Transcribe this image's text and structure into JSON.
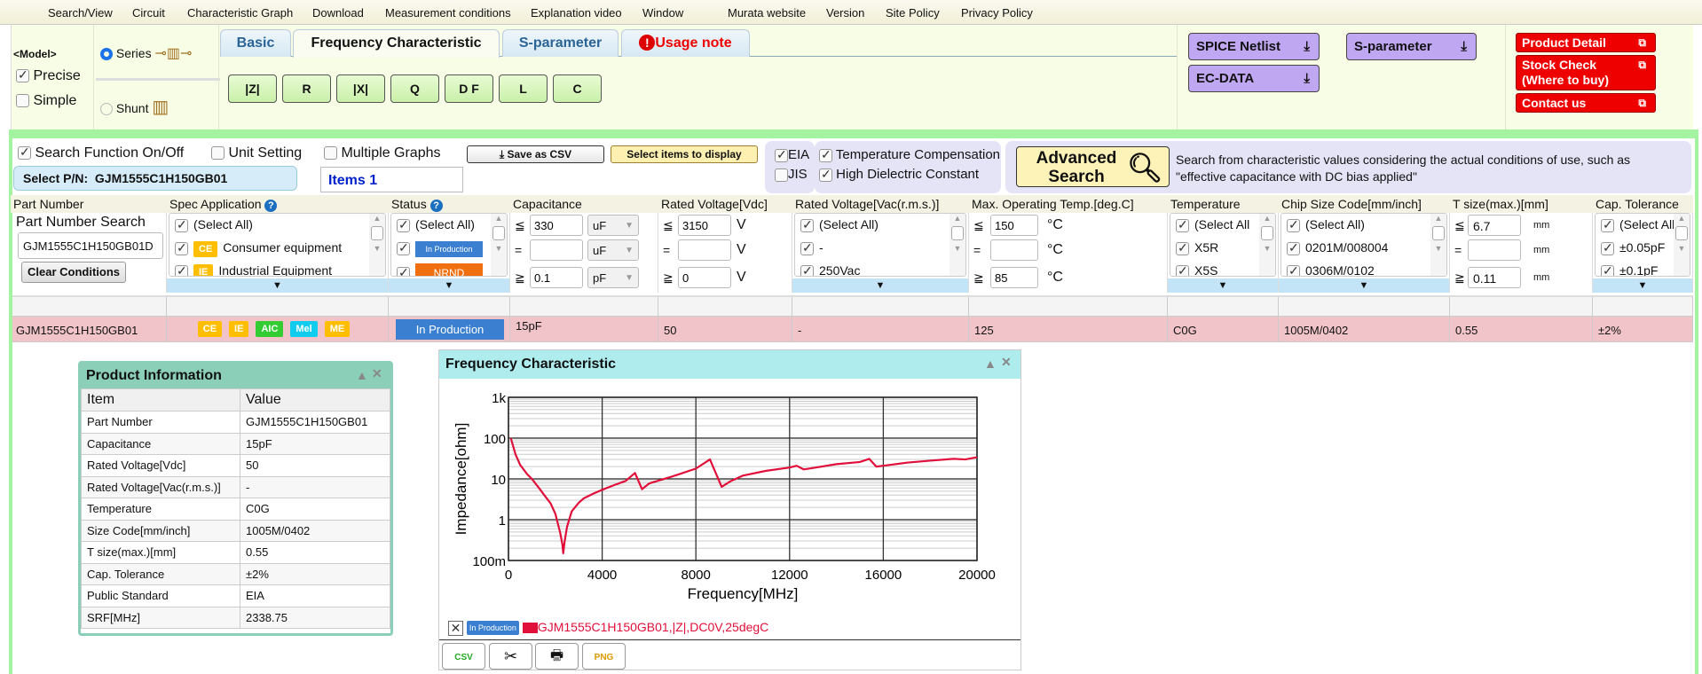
{
  "menu": [
    "Search/View",
    "Circuit",
    "Characteristic Graph",
    "Download",
    "Measurement conditions",
    "Explanation video",
    "Window",
    "Murata website",
    "Version",
    "Site Policy",
    "Privacy Policy"
  ],
  "model": {
    "label": "<Model>",
    "precise": "Precise",
    "simple": "Simple",
    "precise_checked": true,
    "simple_checked": false,
    "series": "Series",
    "shunt": "Shunt",
    "selected": "Series"
  },
  "tabs": [
    {
      "label": "Basic"
    },
    {
      "label": "Frequency Characteristic",
      "active": true
    },
    {
      "label": "S-parameter"
    },
    {
      "label": "Usage note",
      "icon": "exclamation-icon"
    }
  ],
  "graph_buttons": [
    "|Z|",
    "R",
    "|X|",
    "Q",
    "D F",
    "L",
    "C"
  ],
  "downloads": {
    "spice": "SPICE Netlist",
    "sparam": "S-parameter",
    "ecdata": "EC-DATA"
  },
  "links": {
    "product_detail": "Product Detail",
    "stock_check_1": "Stock Check",
    "stock_check_2": "(Where to buy)",
    "contact": "Contact us"
  },
  "search": {
    "search_on": "Search Function On/Off",
    "unit_setting": "Unit Setting",
    "multiple_graphs": "Multiple Graphs",
    "save_csv": "Save as CSV",
    "select_items": "Select items to display",
    "select_pn_label": "Select P/N:",
    "select_pn": "GJM1555C1H150GB01",
    "items": "Items 1",
    "eia": "EIA",
    "jis": "JIS",
    "temp_comp": "Temperature Compensation",
    "high_diel": "High Dielectric Constant",
    "advanced_1": "Advanced",
    "advanced_2": "Search",
    "advanced_desc_1": "Search from characteristic values considering the actual conditions of use, such as",
    "advanced_desc_2": "\"effective capacitance with DC bias applied\""
  },
  "columns": {
    "part_number": {
      "header": "Part Number",
      "search_label": "Part Number Search",
      "search_value": "GJM1555C1H150GB01D",
      "clear": "Clear Conditions"
    },
    "spec": {
      "header": "Spec Application",
      "items": [
        {
          "label": "(Select All)"
        },
        {
          "badge": "CE",
          "label": "Consumer equipment"
        },
        {
          "badge": "IE",
          "label": "Industrial Equipment"
        }
      ]
    },
    "status": {
      "header": "Status",
      "items": [
        "(Select All)",
        "In Production",
        "NRND"
      ]
    },
    "capacitance": {
      "header": "Capacitance",
      "max": "330",
      "max_unit": "uF",
      "eq": "",
      "eq_unit": "uF",
      "min": "0.1",
      "min_unit": "pF"
    },
    "rated_vdc": {
      "header": "Rated Voltage[Vdc]",
      "max": "3150",
      "eq": "",
      "min": "0",
      "unit": "V"
    },
    "rated_vac": {
      "header": "Rated Voltage[Vac(r.m.s.)]",
      "items": [
        "(Select All)",
        "-",
        "250Vac"
      ]
    },
    "max_temp": {
      "header": "Max. Operating Temp.[deg.C]",
      "max": "150",
      "eq": "",
      "min": "85",
      "unit": "°C"
    },
    "temperature": {
      "header": "Temperature",
      "items": [
        "(Select All",
        "X5R",
        "X5S"
      ]
    },
    "chip_size": {
      "header": "Chip Size Code[mm/inch]",
      "items": [
        "(Select All)",
        "0201M/008004",
        "0306M/0102"
      ]
    },
    "t_size": {
      "header": "T size(max.)[mm]",
      "max": "6.7",
      "eq": "",
      "min": "0.11",
      "unit": "mm"
    },
    "cap_tol": {
      "header": "Cap. Tolerance",
      "items": [
        "(Select All)",
        "±0.05pF",
        "±0.1pF"
      ]
    }
  },
  "result_row": {
    "part_number": "GJM1555C1H150GB01",
    "badges": [
      {
        "t": "CE",
        "c": "#ffbf00"
      },
      {
        "t": "IE",
        "c": "#ffbf00"
      },
      {
        "t": "AIC",
        "c": "#33cc33"
      },
      {
        "t": "Mel",
        "c": "#11ccee"
      },
      {
        "t": "ME",
        "c": "#ffbf00"
      }
    ],
    "status": "In Production",
    "capacitance": "15pF",
    "rated_vdc": "50",
    "rated_vac": "-",
    "max_temp": "125",
    "temperature": "C0G",
    "chip_size": "1005M/0402",
    "t_size": "0.55",
    "cap_tol": "±2%"
  },
  "product_info": {
    "title": "Product Information",
    "col_item": "Item",
    "col_value": "Value",
    "rows": [
      [
        "Part Number",
        "GJM1555C1H150GB01"
      ],
      [
        "Capacitance",
        "15pF"
      ],
      [
        "Rated Voltage[Vdc]",
        "50"
      ],
      [
        "Rated Voltage[Vac(r.m.s.)]",
        "-"
      ],
      [
        "Temperature",
        "C0G"
      ],
      [
        "Size Code[mm/inch]",
        "1005M/0402"
      ],
      [
        "T size(max.)[mm]",
        "0.55"
      ],
      [
        "Cap. Tolerance",
        "±2%"
      ],
      [
        "Public Standard",
        "EIA"
      ],
      [
        "SRF[MHz]",
        "2338.75"
      ]
    ]
  },
  "freq_panel": {
    "title": "Frequency Characteristic",
    "legend_status": "In Production",
    "legend_color": "#e0103a",
    "toolbar": [
      "csv-icon",
      "tools-icon",
      "print-icon",
      "png-icon"
    ]
  },
  "chart_data": {
    "type": "line",
    "xlabel": "Frequency[MHz]",
    "ylabel": "Impedance[ohm]",
    "xlim": [
      0,
      20000
    ],
    "ylim": [
      0.1,
      1000
    ],
    "yscale": "log",
    "xticks": [
      "0",
      "4000",
      "8000",
      "12000",
      "16000",
      "20000"
    ],
    "yticks": [
      "100m",
      "1",
      "10",
      "100",
      "1k"
    ],
    "grid": true,
    "series": [
      {
        "name": "GJM1555C1H150GB01,|Z|,DC0V,25degC",
        "color": "#e0103a",
        "x": [
          100,
          300,
          500,
          800,
          1000,
          1300,
          1500,
          1800,
          2000,
          2200,
          2300,
          2338,
          2400,
          2500,
          2700,
          3000,
          3200,
          3600,
          4000,
          4500,
          5000,
          5400,
          5700,
          6000,
          7000,
          8000,
          8600,
          9100,
          9500,
          10000,
          11000,
          12000,
          12300,
          12600,
          13000,
          14000,
          15000,
          15400,
          15700,
          16000,
          17000,
          18000,
          19000,
          19500,
          20000
        ],
        "y": [
          100,
          40,
          22,
          13,
          10,
          6,
          4.2,
          2.5,
          1.4,
          0.5,
          0.25,
          0.15,
          0.3,
          0.67,
          1.6,
          2.6,
          3.3,
          4.3,
          5.4,
          7,
          8.9,
          14,
          5.6,
          7.7,
          11.5,
          17.9,
          30,
          6.4,
          8.9,
          12,
          15.8,
          19,
          21,
          17.1,
          18.5,
          23,
          26,
          31,
          20,
          21,
          25,
          28,
          31,
          30,
          34
        ]
      }
    ]
  }
}
